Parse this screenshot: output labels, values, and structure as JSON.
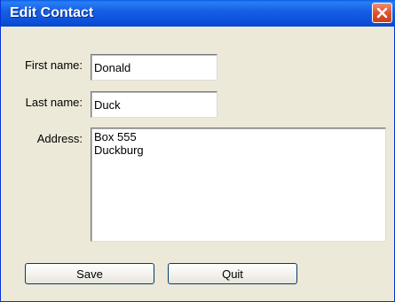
{
  "window": {
    "title": "Edit Contact"
  },
  "form": {
    "first_name_label": "First name:",
    "first_name_value": "Donald",
    "last_name_label": "Last name:",
    "last_name_value": "Duck",
    "address_label": "Address:",
    "address_value": "Box 555\nDuckburg"
  },
  "buttons": {
    "save_label": "Save",
    "quit_label": "Quit"
  },
  "colors": {
    "titlebar": "#0b4fd8",
    "window_bg": "#ece9d8",
    "close_button": "#e0542d"
  },
  "icons": {
    "close": "close-icon"
  }
}
